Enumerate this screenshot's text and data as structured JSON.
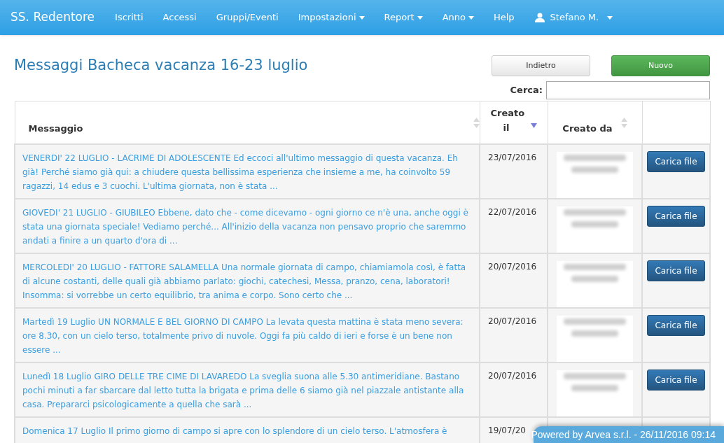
{
  "navbar": {
    "brand": "SS. Redentore",
    "items": [
      {
        "label": "Iscritti",
        "dropdown": false
      },
      {
        "label": "Accessi",
        "dropdown": false
      },
      {
        "label": "Gruppi/Eventi",
        "dropdown": false
      },
      {
        "label": "Impostazioni",
        "dropdown": true
      },
      {
        "label": "Report",
        "dropdown": true
      },
      {
        "label": "Anno",
        "dropdown": true
      },
      {
        "label": "Help",
        "dropdown": false
      }
    ],
    "user": "Stefano M."
  },
  "title": "Messaggi Bacheca vacanza 16-23 luglio",
  "buttons": [
    {
      "label": "Indietro",
      "kind": "default"
    },
    {
      "label": "Nuovo",
      "kind": "success"
    }
  ],
  "search": {
    "label": "Cerca:"
  },
  "table": {
    "columns": [
      {
        "label": "Messaggio",
        "selected": false
      },
      {
        "label": "Creato il",
        "selected": true
      },
      {
        "label": "Creato da",
        "selected": false
      }
    ],
    "rows": [
      {
        "message": "VENERDI' 22 LUGLIO - LACRIME DI ADOLESCENTE Ed eccoci all'ultimo messaggio di questa vacanza. Eh già! Perché siamo già qui: a chiudere questa bellissima esperienza che insieme a me, ha coinvolto 59 ragazzi, 14 edus e 3 cuochi. L'ultima giornata, non è stata ...",
        "date": "23/07/2016",
        "action": "Carica file"
      },
      {
        "message": "GIOVEDI' 21 LUGLIO - GIUBILEO Ebbene, dato che - come dicevamo - ogni giorno ce n'è una, anche oggi è stata una giornata speciale! Vediamo perché... All'inizio della vacanza non pensavo proprio che saremmo andati a finire a un quarto d'ora di ...",
        "date": "22/07/2016",
        "action": "Carica file"
      },
      {
        "message": "MERCOLEDI' 20 LUGLIO - FATTORE SALAMELLA Una normale giornata di campo, chiamiamola così, è fatta di alcune costanti, delle quali già abbiamo parlato: giochi, catechesi, Messa, pranzo, cena, laboratori! Insomma: si vorrebbe un certo equilibrio, tra anima e corpo. Sono certo che ...",
        "date": "20/07/2016",
        "action": "Carica file"
      },
      {
        "message": "Martedì 19 Luglio UN NORMALE E BEL GIORNO DI CAMPO La levata questa mattina è stata meno severa: ore 8.30, con un cielo terso, totalmente privo di nuvole. Oggi fa più caldo di ieri e forse è un bene non essere ...",
        "date": "20/07/2016",
        "action": "Carica file"
      },
      {
        "message": "Lunedì 18 Luglio GIRO DELLE TRE CIME DI LAVAREDO La sveglia suona alle 5.30 antimeridiane. Bastano pochi minuti a far sbarcare dal letto tutta la brigata e prima delle 6 siamo già nel piazzale antistante alla casa. Prepararci psicologicamente a quella che sarà ...",
        "date": "20/07/2016",
        "action": "Carica file"
      },
      {
        "message": "Domenica 17 Luglio Il primo giorno di campo si apre con lo splendore di un cielo terso. L'atmosfera è",
        "date": "19/07/20"
      }
    ]
  },
  "footer": "Powered by Arvea s.r.l. - 26/11/2016 09:14"
}
